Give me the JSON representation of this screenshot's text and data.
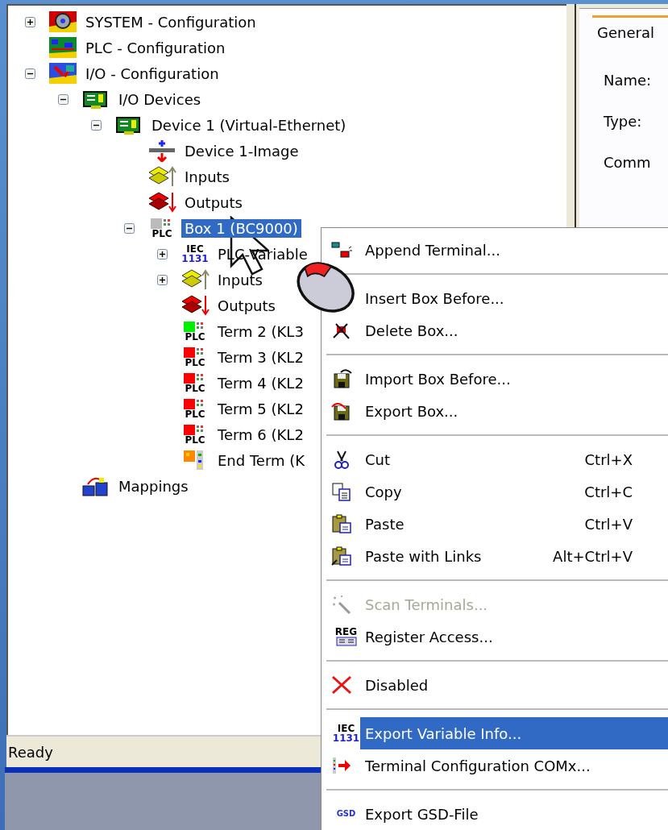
{
  "tree": {
    "nodes": [
      {
        "label": "SYSTEM - Configuration",
        "kind": "system",
        "expanded": false,
        "selected": false
      },
      {
        "label": "PLC - Configuration",
        "kind": "plc-config",
        "selected": false
      },
      {
        "label": "I/O - Configuration",
        "kind": "io-config",
        "expanded": true,
        "selected": false,
        "children": [
          {
            "label": "I/O Devices",
            "kind": "io-devices",
            "expanded": true,
            "selected": false,
            "children": [
              {
                "label": "Device 1 (Virtual-Ethernet)",
                "kind": "device",
                "expanded": true,
                "selected": false,
                "children": [
                  {
                    "label": "Device 1-Image",
                    "kind": "image",
                    "selected": false
                  },
                  {
                    "label": "Inputs",
                    "kind": "inputs",
                    "selected": false
                  },
                  {
                    "label": "Outputs",
                    "kind": "outputs",
                    "selected": false
                  },
                  {
                    "label": "Box 1 (BC9000)",
                    "kind": "box",
                    "caption": [
                      "PLC"
                    ],
                    "expanded": true,
                    "selected": true,
                    "children": [
                      {
                        "label": "PLC-Variable",
                        "kind": "iec",
                        "caption": [
                          "IEC",
                          "1131"
                        ],
                        "expanded": false,
                        "selected": false
                      },
                      {
                        "label": "Inputs",
                        "kind": "inputs",
                        "expanded": false,
                        "selected": false
                      },
                      {
                        "label": "Outputs",
                        "kind": "outputs",
                        "selected": false
                      },
                      {
                        "label": "Term 2 (KL3",
                        "kind": "terminal",
                        "caption": [
                          "PLC"
                        ],
                        "color": "#00ee00",
                        "selected": false
                      },
                      {
                        "label": "Term 3 (KL2",
                        "kind": "terminal",
                        "caption": [
                          "PLC"
                        ],
                        "color": "#ff0000",
                        "selected": false
                      },
                      {
                        "label": "Term 4 (KL2",
                        "kind": "terminal",
                        "caption": [
                          "PLC"
                        ],
                        "color": "#ff0000",
                        "selected": false
                      },
                      {
                        "label": "Term 5 (KL2",
                        "kind": "terminal",
                        "caption": [
                          "PLC"
                        ],
                        "color": "#ff0000",
                        "selected": false
                      },
                      {
                        "label": "Term 6 (KL2",
                        "kind": "terminal",
                        "caption": [
                          "PLC"
                        ],
                        "color": "#ff0000",
                        "selected": false
                      },
                      {
                        "label": "End Term (K",
                        "kind": "end-term",
                        "selected": false
                      }
                    ]
                  }
                ]
              }
            ]
          },
          {
            "label": "Mappings",
            "kind": "mappings",
            "selected": false
          }
        ]
      }
    ]
  },
  "details": {
    "tab": {
      "label": "General",
      "selected": true
    },
    "fields": [
      "Name:",
      "Type:",
      "Comm"
    ]
  },
  "status_bar": "Ready",
  "context_menu": [
    {
      "kind": "item",
      "label": "Append Terminal...",
      "selected": false,
      "disabled": false
    },
    {
      "kind": "separator"
    },
    {
      "kind": "item",
      "label": "Insert Box Before...",
      "selected": false,
      "disabled": false
    },
    {
      "kind": "item",
      "label": "Delete Box...",
      "selected": false,
      "disabled": false
    },
    {
      "kind": "separator"
    },
    {
      "kind": "item",
      "label": "Import Box Before...",
      "selected": false,
      "disabled": false
    },
    {
      "kind": "item",
      "label": "Export Box...",
      "selected": false,
      "disabled": false
    },
    {
      "kind": "separator"
    },
    {
      "kind": "item",
      "label": "Cut",
      "shortcut": "Ctrl+X",
      "selected": false,
      "disabled": false
    },
    {
      "kind": "item",
      "label": "Copy",
      "shortcut": "Ctrl+C",
      "selected": false,
      "disabled": false
    },
    {
      "kind": "item",
      "label": "Paste",
      "shortcut": "Ctrl+V",
      "selected": false,
      "disabled": false
    },
    {
      "kind": "item",
      "label": "Paste with Links",
      "shortcut": "Alt+Ctrl+V",
      "selected": false,
      "disabled": false
    },
    {
      "kind": "separator"
    },
    {
      "kind": "item",
      "label": "Scan Terminals...",
      "selected": false,
      "disabled": true
    },
    {
      "kind": "item",
      "label": "Register Access...",
      "caption": [
        "REG"
      ],
      "selected": false,
      "disabled": false
    },
    {
      "kind": "separator"
    },
    {
      "kind": "item",
      "label": "Disabled",
      "selected": false,
      "disabled": false
    },
    {
      "kind": "separator"
    },
    {
      "kind": "item",
      "label": "Export Variable Info...",
      "caption": [
        "IEC",
        "1131"
      ],
      "selected": true,
      "disabled": false
    },
    {
      "kind": "item",
      "label": "Terminal Configuration COMx...",
      "selected": false,
      "disabled": false
    },
    {
      "kind": "separator"
    },
    {
      "kind": "item",
      "label": "Export GSD-File",
      "caption": [
        "GSD"
      ],
      "selected": false,
      "disabled": false
    }
  ]
}
